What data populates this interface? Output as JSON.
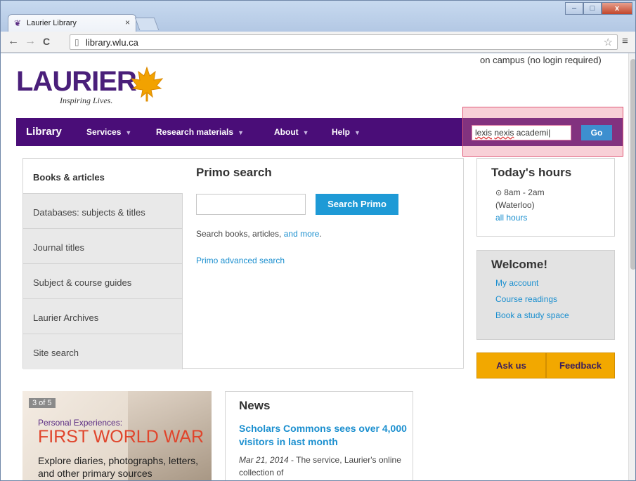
{
  "browser": {
    "tab_title": "Laurier Library",
    "tab_close": "×",
    "url": "library.wlu.ca",
    "back": "←",
    "forward": "→",
    "reload": "C",
    "star": "☆",
    "menu": "≡",
    "minimize": "–",
    "maximize": "□",
    "close": "x"
  },
  "header": {
    "campus_note": "on campus (no login required)",
    "logo_text": "LAURIER",
    "logo_tagline": "Inspiring Lives."
  },
  "nav": {
    "brand": "Library",
    "items": [
      {
        "label": "Services"
      },
      {
        "label": "Research materials"
      },
      {
        "label": "About"
      },
      {
        "label": "Help"
      }
    ],
    "caret": "▼",
    "search_value_words": [
      "lexis",
      "nexis"
    ],
    "search_value_rest": " academi",
    "go_label": "Go"
  },
  "tabs": [
    {
      "label": "Books & articles"
    },
    {
      "label": "Databases: subjects & titles"
    },
    {
      "label": "Journal titles"
    },
    {
      "label": "Subject & course guides"
    },
    {
      "label": "Laurier Archives"
    },
    {
      "label": "Site search"
    }
  ],
  "primo": {
    "title": "Primo search",
    "button": "Search Primo",
    "desc_text": "Search books, articles, ",
    "desc_link": "and more",
    "desc_end": ".",
    "advanced": "Primo advanced search"
  },
  "hours": {
    "title": "Today's hours",
    "clock": "⊙",
    "time": "8am - 2am",
    "location": "(Waterloo)",
    "all_hours": "all hours"
  },
  "welcome": {
    "title": "Welcome!",
    "links": [
      "My account",
      "Course readings",
      "Book a study space"
    ]
  },
  "actions": {
    "ask": "Ask us",
    "feedback": "Feedback"
  },
  "carousel": {
    "counter": "3 of 5",
    "kicker": "Personal Experiences:",
    "title": "FIRST WORLD WAR",
    "body": "Explore diaries, photographs, letters, and other primary sources"
  },
  "news": {
    "title": "News",
    "headline": "Scholars Commons sees over 4,000 visitors in last month",
    "date": "Mar 21, 2014",
    "body": " - The service, Laurier's online collection of"
  }
}
